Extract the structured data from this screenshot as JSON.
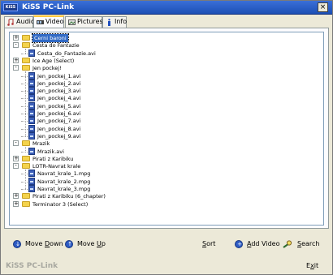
{
  "window": {
    "title": "KiSS PC-Link",
    "logo_text": "KiSS",
    "close_label": "×"
  },
  "tabs": [
    {
      "label": "Audio",
      "icon": "music-note-icon",
      "active": false
    },
    {
      "label": "Video",
      "icon": "film-icon",
      "active": true
    },
    {
      "label": "Pictures",
      "icon": "pictures-icon",
      "active": false
    },
    {
      "label": "Info",
      "icon": "info-icon",
      "active": false
    }
  ],
  "tree": {
    "items": [
      {
        "label": "Cerni baroni",
        "level": 0,
        "type": "folder",
        "expander": "+",
        "selected": true
      },
      {
        "label": "Cesta do Fantazie",
        "level": 0,
        "type": "folder",
        "expander": "-"
      },
      {
        "label": "Cesta_do_Fantazie.avi",
        "level": 1,
        "type": "file"
      },
      {
        "label": "Ice Age (Select)",
        "level": 0,
        "type": "folder",
        "expander": "+"
      },
      {
        "label": "Jen pockej!",
        "level": 0,
        "type": "folder",
        "expander": "-"
      },
      {
        "label": "Jen_pockej_1.avi",
        "level": 1,
        "type": "file"
      },
      {
        "label": "Jen_pockej_2.avi",
        "level": 1,
        "type": "file"
      },
      {
        "label": "Jen_pockej_3.avi",
        "level": 1,
        "type": "file"
      },
      {
        "label": "Jen_pockej_4.avi",
        "level": 1,
        "type": "file"
      },
      {
        "label": "Jen_pockej_5.avi",
        "level": 1,
        "type": "file"
      },
      {
        "label": "Jen_pockej_6.avi",
        "level": 1,
        "type": "file"
      },
      {
        "label": "Jen_pockej_7.avi",
        "level": 1,
        "type": "file"
      },
      {
        "label": "Jen_pockej_8.avi",
        "level": 1,
        "type": "file"
      },
      {
        "label": "Jen_pockej_9.avi",
        "level": 1,
        "type": "file"
      },
      {
        "label": "Mrazik",
        "level": 0,
        "type": "folder",
        "expander": "-"
      },
      {
        "label": "Mrazik.avi",
        "level": 1,
        "type": "file"
      },
      {
        "label": "Pirati z Karibiku",
        "level": 0,
        "type": "folder",
        "expander": "+"
      },
      {
        "label": "LOTR-Navrat krale",
        "level": 0,
        "type": "folder",
        "expander": "-"
      },
      {
        "label": "Navrat_krale_1.mpg",
        "level": 1,
        "type": "file"
      },
      {
        "label": "Navrat_krale_2.mpg",
        "level": 1,
        "type": "file"
      },
      {
        "label": "Navrat_krale_3.mpg",
        "level": 1,
        "type": "file"
      },
      {
        "label": "Pirati z Karibiku (6_chapter)",
        "level": 0,
        "type": "folder",
        "expander": "+"
      },
      {
        "label": "Terminator 3 (Select)",
        "level": 0,
        "type": "folder",
        "expander": "+"
      }
    ]
  },
  "toolbar": {
    "move_down": {
      "prefix": "Move ",
      "accel": "D",
      "suffix": "own",
      "icon": "arrow-down-icon"
    },
    "move_up": {
      "prefix": "Move ",
      "accel": "U",
      "suffix": "p",
      "icon": "arrow-up-icon"
    },
    "sort": {
      "prefix": "",
      "accel": "S",
      "suffix": "ort"
    },
    "add_video": {
      "prefix": "",
      "accel": "A",
      "suffix": "dd Video",
      "icon": "plus-icon"
    },
    "search": {
      "prefix": "",
      "accel": "S",
      "suffix": "earch",
      "icon": "search-icon"
    }
  },
  "footer": {
    "brand": "KiSS PC-Link",
    "exit_prefix": "E",
    "exit_accel": "x",
    "exit_suffix": "it"
  },
  "colors": {
    "titlebar": "#1c4fb5",
    "selection": "#316ac5",
    "tab_highlight": "#ffc83c",
    "folder": "#f4d34c",
    "file": "#3c5fb8"
  }
}
